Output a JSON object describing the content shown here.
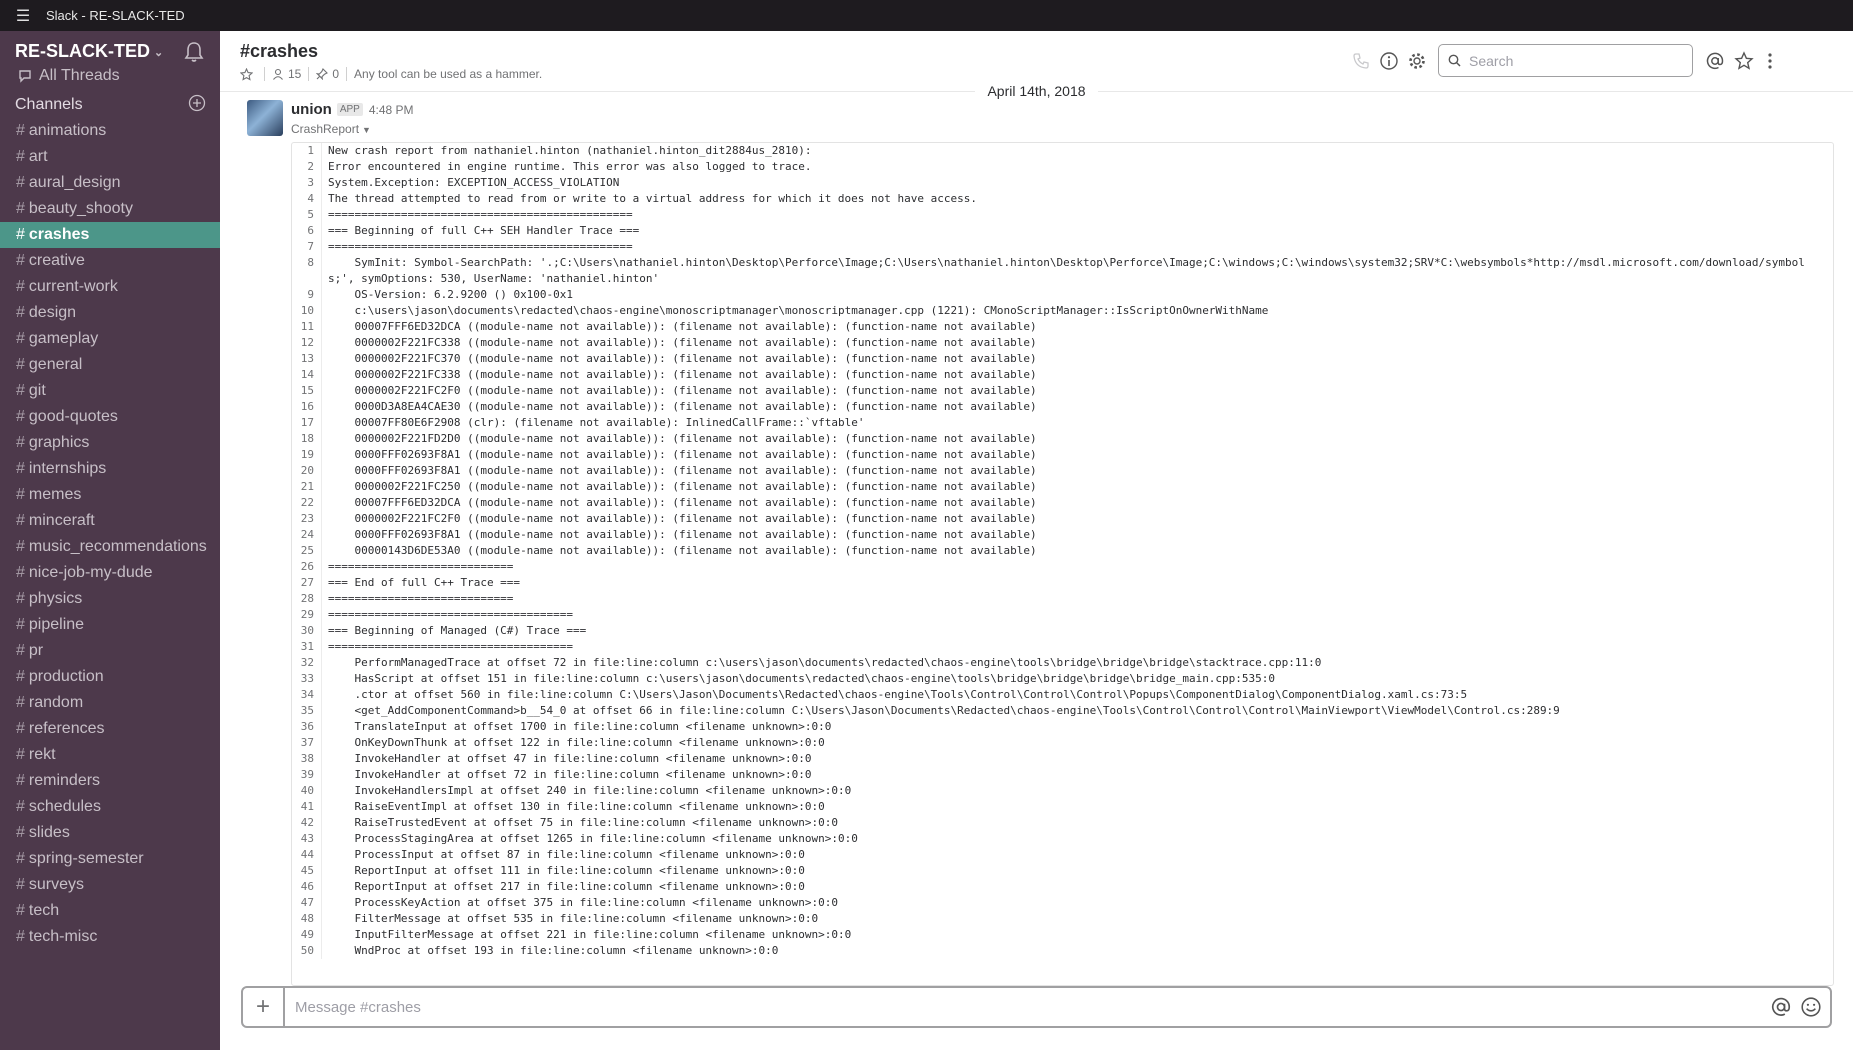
{
  "window": {
    "title": "Slack - RE-SLACK-TED",
    "menu_icon": "hamburger-icon"
  },
  "sidebar": {
    "team_name": "RE-SLACK-TED",
    "all_threads_label": "All Threads",
    "channels_header": "Channels",
    "channels": [
      {
        "name": "animations"
      },
      {
        "name": "art"
      },
      {
        "name": "aural_design"
      },
      {
        "name": "beauty_shooty"
      },
      {
        "name": "crashes",
        "active": true
      },
      {
        "name": "creative"
      },
      {
        "name": "current-work"
      },
      {
        "name": "design"
      },
      {
        "name": "gameplay"
      },
      {
        "name": "general"
      },
      {
        "name": "git"
      },
      {
        "name": "good-quotes"
      },
      {
        "name": "graphics"
      },
      {
        "name": "internships"
      },
      {
        "name": "memes"
      },
      {
        "name": "minceraft"
      },
      {
        "name": "music_recommendations"
      },
      {
        "name": "nice-job-my-dude"
      },
      {
        "name": "physics"
      },
      {
        "name": "pipeline"
      },
      {
        "name": "pr"
      },
      {
        "name": "production"
      },
      {
        "name": "random"
      },
      {
        "name": "references"
      },
      {
        "name": "rekt"
      },
      {
        "name": "reminders"
      },
      {
        "name": "schedules"
      },
      {
        "name": "slides"
      },
      {
        "name": "spring-semester"
      },
      {
        "name": "surveys"
      },
      {
        "name": "tech"
      },
      {
        "name": "tech-misc"
      }
    ],
    "colors": {
      "background": "#4d394b",
      "active": "#4c9689"
    }
  },
  "header": {
    "channel_name": "#crashes",
    "member_count": "15",
    "pinned_count": "0",
    "topic": "Any tool can be used as a hammer.",
    "search_placeholder": "Search"
  },
  "message": {
    "date": "April 14th, 2018",
    "sender": "union",
    "badge": "APP",
    "time": "4:48 PM",
    "attachment_name": "CrashReport",
    "code_lines": [
      "New crash report from nathaniel.hinton (nathaniel.hinton_dit2884us_2810):",
      "Error encountered in engine runtime. This error was also logged to trace.",
      "System.Exception: EXCEPTION_ACCESS_VIOLATION",
      "The thread attempted to read from or write to a virtual address for which it does not have access.",
      "==============================================",
      "=== Beginning of full C++ SEH Handler Trace ===",
      "==============================================",
      "    SymInit: Symbol-SearchPath: '.;C:\\Users\\nathaniel.hinton\\Desktop\\Perforce\\Image;C:\\Users\\nathaniel.hinton\\Desktop\\Perforce\\Image;C:\\windows;C:\\windows\\system32;SRV*C:\\websymbols*http://msdl.microsoft.com/download/symbols;', symOptions: 530, UserName: 'nathaniel.hinton'",
      "    OS-Version: 6.2.9200 () 0x100-0x1",
      "    c:\\users\\jason\\documents\\redacted\\chaos-engine\\monoscriptmanager\\monoscriptmanager.cpp (1221): CMonoScriptManager::IsScriptOnOwnerWithName",
      "    00007FFF6ED32DCA ((module-name not available)): (filename not available): (function-name not available)",
      "    0000002F221FC338 ((module-name not available)): (filename not available): (function-name not available)",
      "    0000002F221FC370 ((module-name not available)): (filename not available): (function-name not available)",
      "    0000002F221FC338 ((module-name not available)): (filename not available): (function-name not available)",
      "    0000002F221FC2F0 ((module-name not available)): (filename not available): (function-name not available)",
      "    0000D3A8EA4CAE30 ((module-name not available)): (filename not available): (function-name not available)",
      "    00007FF80E6F2908 (clr): (filename not available): InlinedCallFrame::`vftable'",
      "    0000002F221FD2D0 ((module-name not available)): (filename not available): (function-name not available)",
      "    0000FFF02693F8A1 ((module-name not available)): (filename not available): (function-name not available)",
      "    0000FFF02693F8A1 ((module-name not available)): (filename not available): (function-name not available)",
      "    0000002F221FC250 ((module-name not available)): (filename not available): (function-name not available)",
      "    00007FFF6ED32DCA ((module-name not available)): (filename not available): (function-name not available)",
      "    0000002F221FC2F0 ((module-name not available)): (filename not available): (function-name not available)",
      "    0000FFF02693F8A1 ((module-name not available)): (filename not available): (function-name not available)",
      "    00000143D6DE53A0 ((module-name not available)): (filename not available): (function-name not available)",
      "============================",
      "=== End of full C++ Trace ===",
      "============================",
      "=====================================",
      "=== Beginning of Managed (C#) Trace ===",
      "=====================================",
      "    PerformManagedTrace at offset 72 in file:line:column c:\\users\\jason\\documents\\redacted\\chaos-engine\\tools\\bridge\\bridge\\bridge\\stacktrace.cpp:11:0",
      "    HasScript at offset 151 in file:line:column c:\\users\\jason\\documents\\redacted\\chaos-engine\\tools\\bridge\\bridge\\bridge\\bridge_main.cpp:535:0",
      "    .ctor at offset 560 in file:line:column C:\\Users\\Jason\\Documents\\Redacted\\chaos-engine\\Tools\\Control\\Control\\Control\\Popups\\ComponentDialog\\ComponentDialog.xaml.cs:73:5",
      "    <get_AddComponentCommand>b__54_0 at offset 66 in file:line:column C:\\Users\\Jason\\Documents\\Redacted\\chaos-engine\\Tools\\Control\\Control\\Control\\MainViewport\\ViewModel\\Control.cs:289:9",
      "    TranslateInput at offset 1700 in file:line:column <filename unknown>:0:0",
      "    OnKeyDownThunk at offset 122 in file:line:column <filename unknown>:0:0",
      "    InvokeHandler at offset 47 in file:line:column <filename unknown>:0:0",
      "    InvokeHandler at offset 72 in file:line:column <filename unknown>:0:0",
      "    InvokeHandlersImpl at offset 240 in file:line:column <filename unknown>:0:0",
      "    RaiseEventImpl at offset 130 in file:line:column <filename unknown>:0:0",
      "    RaiseTrustedEvent at offset 75 in file:line:column <filename unknown>:0:0",
      "    ProcessStagingArea at offset 1265 in file:line:column <filename unknown>:0:0",
      "    ProcessInput at offset 87 in file:line:column <filename unknown>:0:0",
      "    ReportInput at offset 111 in file:line:column <filename unknown>:0:0",
      "    ReportInput at offset 217 in file:line:column <filename unknown>:0:0",
      "    ProcessKeyAction at offset 375 in file:line:column <filename unknown>:0:0",
      "    FilterMessage at offset 535 in file:line:column <filename unknown>:0:0",
      "    InputFilterMessage at offset 221 in file:line:column <filename unknown>:0:0",
      "    WndProc at offset 193 in file:line:column <filename unknown>:0:0"
    ]
  },
  "composer": {
    "placeholder": "Message #crashes"
  }
}
